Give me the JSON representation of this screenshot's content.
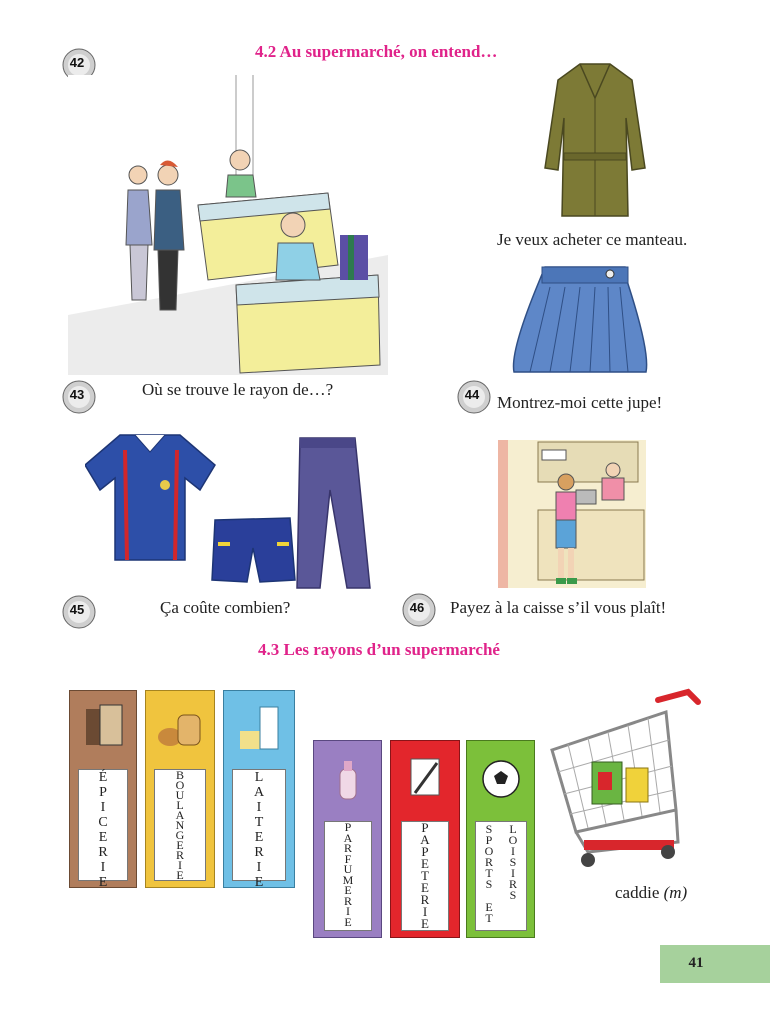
{
  "section_42": {
    "number": "42",
    "heading": "4.2 Au supermarché, on entend…"
  },
  "captions": {
    "coat": "Je veux acheter ce manteau.",
    "where": "Où se trouve le rayon de…?",
    "skirt": "Montrez-moi cette jupe!",
    "price": "Ça coûte combien?",
    "pay": "Payez à la caisse s’il vous plaît!"
  },
  "numbers": {
    "n43": "43",
    "n44": "44",
    "n45": "45",
    "n46": "46"
  },
  "section_43": {
    "heading": "4.3 Les rayons d’un supermarché"
  },
  "rayons": {
    "epicerie": [
      "É",
      "P",
      "I",
      "C",
      "E",
      "R",
      "I",
      "E"
    ],
    "boulangerie": [
      "B",
      "O",
      "U",
      "L",
      "A",
      "N",
      "G",
      "E",
      "R",
      "I",
      "E"
    ],
    "laiterie": [
      "L",
      "A",
      "I",
      "T",
      "E",
      "R",
      "I",
      "E"
    ],
    "parfumerie": [
      "P",
      "A",
      "R",
      "F",
      "U",
      "M",
      "E",
      "R",
      "I",
      "E"
    ],
    "papeterie": [
      "P",
      "A",
      "P",
      "E",
      "T",
      "E",
      "R",
      "I",
      "E"
    ],
    "sports": [
      "S",
      "P",
      "O",
      "R",
      "T",
      "S"
    ],
    "et": [
      "E",
      "T"
    ],
    "loisirs": [
      "L",
      "O",
      "I",
      "S",
      "I",
      "R",
      "S"
    ]
  },
  "caddie": {
    "word": "caddie",
    "gender": "(m)"
  },
  "page_number": "41",
  "colors": {
    "heading": "#e0238a",
    "page_box": "#a6d19c"
  }
}
